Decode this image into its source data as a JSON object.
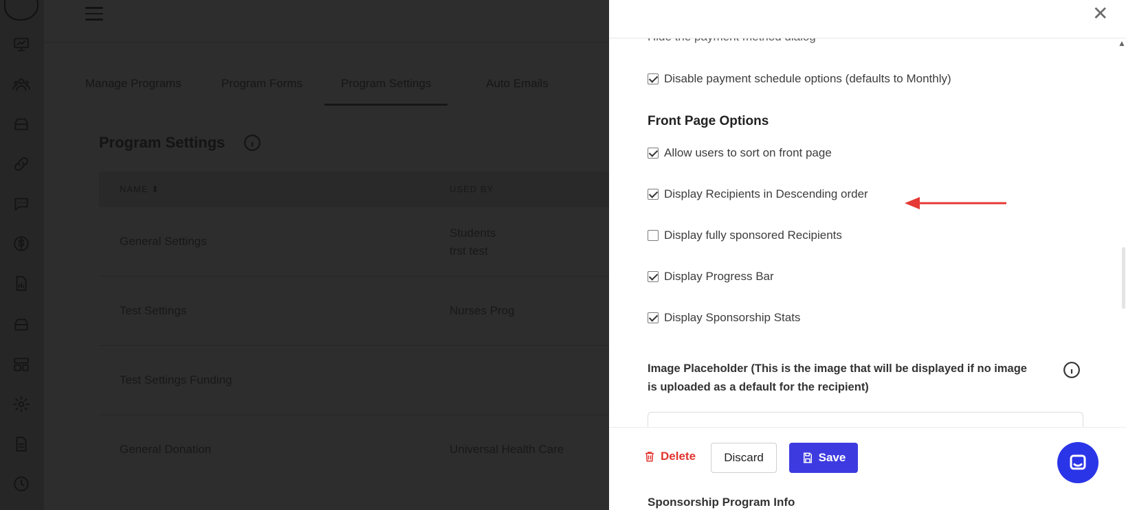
{
  "sidebar": {
    "icons": [
      "presentation-icon",
      "users-icon",
      "inbox-icon",
      "link-icon",
      "chat-icon",
      "dollar-icon",
      "report-icon",
      "programs-icon",
      "layout-icon",
      "gear-icon",
      "document-icon",
      "clock-icon"
    ],
    "active_index": 7
  },
  "tabs": [
    {
      "label": "Manage Programs"
    },
    {
      "label": "Program Forms"
    },
    {
      "label": "Program Settings"
    },
    {
      "label": "Auto Emails"
    }
  ],
  "page": {
    "title": "Program Settings"
  },
  "table": {
    "columns": [
      "NAME ⬍",
      "USED BY"
    ],
    "rows": [
      {
        "name": "General Settings",
        "used_by_1": "Students",
        "used_by_2": "trst test"
      },
      {
        "name": "Test Settings",
        "used_by_1": "Nurses Prog",
        "used_by_2": ""
      },
      {
        "name": "Test Settings Funding",
        "used_by_1": "",
        "used_by_2": ""
      },
      {
        "name": "General Donation",
        "used_by_1": "Universal Health Care",
        "used_by_2": ""
      }
    ]
  },
  "drawer": {
    "partial_option": "Hide the payment method dialog",
    "options_top": [
      {
        "label": "Disable payment schedule options (defaults to Monthly)",
        "checked": true
      }
    ],
    "front_page_heading": "Front Page Options",
    "front_page_options": [
      {
        "label": "Allow users to sort on front page",
        "checked": true
      },
      {
        "label": "Display Recipients in Descending order",
        "checked": true
      },
      {
        "label": "Display fully sponsored Recipients",
        "checked": false
      },
      {
        "label": "Display Progress Bar",
        "checked": true
      },
      {
        "label": "Display Sponsorship Stats",
        "checked": true
      }
    ],
    "image_placeholder_label": "Image Placeholder (This is the image that will be displayed if no image is uploaded as a default for the recipient)",
    "next_section": "Sponsorship Program Info",
    "footer": {
      "delete_label": "Delete",
      "discard_label": "Discard",
      "save_label": "Save"
    }
  },
  "colors": {
    "primary": "#3d3be0",
    "danger": "#e0332d",
    "annotation_arrow": "#e53935",
    "chat": "#2b35e8"
  }
}
